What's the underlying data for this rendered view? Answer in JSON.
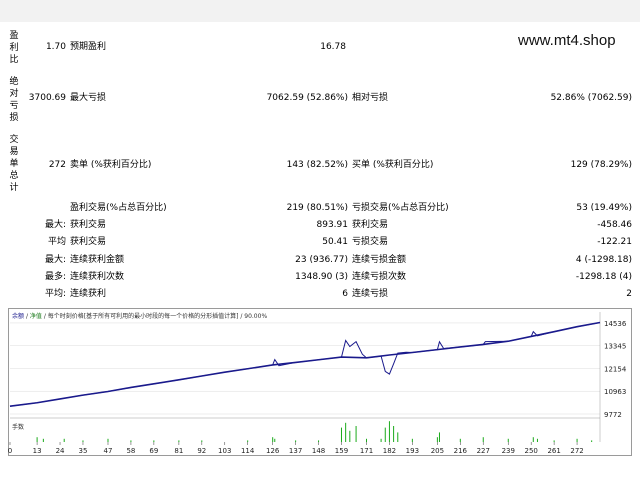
{
  "watermark": "www.mt4.shop",
  "left_labels": {
    "a": [
      "盈",
      "利",
      "比"
    ],
    "b": [
      "绝",
      "对",
      "亏",
      "损"
    ],
    "c": [
      "交",
      "易",
      "单",
      "总",
      "计"
    ]
  },
  "rows": {
    "r1": {
      "v1": "1.70",
      "l1": "预期盈利",
      "v2": "16.78"
    },
    "r2": {
      "v1": "3700.69",
      "l1": "最大亏损",
      "v2": "7062.59 (52.86%)",
      "l2": "相对亏损",
      "v3": "52.86% (7062.59)"
    },
    "r3": {
      "v1": "272",
      "l1": "卖单 (%获利百分比)",
      "v2": "143 (82.52%)",
      "l2": "买单 (%获利百分比)",
      "v3": "129 (78.29%)"
    },
    "r4": {
      "l1": "盈利交易(%占总百分比)",
      "v2": "219 (80.51%)",
      "l2": "亏损交易(%占总百分比)",
      "v3": "53 (19.49%)"
    },
    "r5": {
      "p": "最大:",
      "l1": "获利交易",
      "v2": "893.91",
      "l2": "获利交易",
      "v3": "-458.46"
    },
    "r6": {
      "p": "平均",
      "l1": "获利交易",
      "v2": "50.41",
      "l2": "亏损交易",
      "v3": "-122.21"
    },
    "r7": {
      "p": "最大:",
      "l1": "连续获利金额",
      "v2": "23 (936.77)",
      "l2": "连续亏损金额",
      "v3": "4 (-1298.18)"
    },
    "r8": {
      "p": "最多:",
      "l1": "连续获利次数",
      "v2": "1348.90 (3)",
      "l2": "连续亏损次数",
      "v3": "-1298.18 (4)"
    },
    "r9": {
      "p": "平均:",
      "l1": "连续获利",
      "v2": "6",
      "l2": "连续亏损",
      "v3": "2"
    }
  },
  "chart_legend": {
    "a": "余额",
    "b": "净值",
    "c": "每个时刻价格[基于所有可利用的最小时段的每一个价格的分形插值计算] / 90.00%"
  },
  "volume_label": "手数",
  "colors": {
    "balance": "#1a1a8c",
    "equity": "#1a1a8c",
    "volume": "#1aaa1a",
    "grid": "#dcdcdc"
  },
  "chart_data": {
    "type": "line",
    "x_ticks": [
      0,
      13,
      24,
      35,
      47,
      58,
      69,
      81,
      92,
      103,
      114,
      126,
      137,
      148,
      159,
      171,
      182,
      193,
      205,
      216,
      227,
      239,
      250,
      261,
      272
    ],
    "y_ticks": [
      9772,
      10963,
      12154,
      13345,
      14536
    ],
    "ylim": [
      9772,
      14900
    ],
    "xlim": [
      0,
      283
    ],
    "balance": [
      [
        0,
        10180
      ],
      [
        13,
        10360
      ],
      [
        24,
        10560
      ],
      [
        35,
        10760
      ],
      [
        47,
        10950
      ],
      [
        58,
        11160
      ],
      [
        69,
        11350
      ],
      [
        81,
        11560
      ],
      [
        92,
        11760
      ],
      [
        103,
        11960
      ],
      [
        114,
        12140
      ],
      [
        126,
        12340
      ],
      [
        137,
        12470
      ],
      [
        148,
        12610
      ],
      [
        159,
        12750
      ],
      [
        171,
        12710
      ],
      [
        182,
        12860
      ],
      [
        193,
        12990
      ],
      [
        205,
        13140
      ],
      [
        216,
        13280
      ],
      [
        227,
        13410
      ],
      [
        239,
        13580
      ],
      [
        250,
        13830
      ],
      [
        261,
        14080
      ],
      [
        272,
        14340
      ],
      [
        283,
        14560
      ]
    ],
    "equity": [
      [
        0,
        10180
      ],
      [
        13,
        10360
      ],
      [
        24,
        10560
      ],
      [
        35,
        10760
      ],
      [
        47,
        10950
      ],
      [
        58,
        11160
      ],
      [
        69,
        11350
      ],
      [
        81,
        11560
      ],
      [
        92,
        11760
      ],
      [
        103,
        11960
      ],
      [
        114,
        12140
      ],
      [
        126,
        12340
      ],
      [
        127,
        12620
      ],
      [
        129,
        12300
      ],
      [
        137,
        12470
      ],
      [
        148,
        12610
      ],
      [
        159,
        12750
      ],
      [
        161,
        13620
      ],
      [
        163,
        13300
      ],
      [
        166,
        13560
      ],
      [
        169,
        12900
      ],
      [
        171,
        12710
      ],
      [
        178,
        12800
      ],
      [
        180,
        12000
      ],
      [
        182,
        11860
      ],
      [
        184,
        12400
      ],
      [
        186,
        12960
      ],
      [
        190,
        13000
      ],
      [
        193,
        12990
      ],
      [
        205,
        13140
      ],
      [
        206,
        13550
      ],
      [
        208,
        13200
      ],
      [
        216,
        13280
      ],
      [
        227,
        13410
      ],
      [
        228,
        13560
      ],
      [
        239,
        13580
      ],
      [
        250,
        13830
      ],
      [
        251,
        14080
      ],
      [
        253,
        13860
      ],
      [
        261,
        14080
      ],
      [
        272,
        14340
      ],
      [
        283,
        14560
      ]
    ],
    "volume": [
      [
        13,
        3
      ],
      [
        16,
        2
      ],
      [
        26,
        2
      ],
      [
        35,
        1
      ],
      [
        47,
        2
      ],
      [
        58,
        1
      ],
      [
        69,
        1
      ],
      [
        81,
        1
      ],
      [
        92,
        1
      ],
      [
        114,
        1
      ],
      [
        126,
        3
      ],
      [
        127,
        2
      ],
      [
        137,
        1
      ],
      [
        148,
        1
      ],
      [
        159,
        9
      ],
      [
        161,
        12
      ],
      [
        163,
        7
      ],
      [
        166,
        10
      ],
      [
        171,
        2
      ],
      [
        178,
        2
      ],
      [
        180,
        9
      ],
      [
        182,
        13
      ],
      [
        184,
        10
      ],
      [
        186,
        6
      ],
      [
        193,
        2
      ],
      [
        205,
        3
      ],
      [
        206,
        6
      ],
      [
        216,
        2
      ],
      [
        227,
        3
      ],
      [
        239,
        2
      ],
      [
        251,
        3
      ],
      [
        253,
        2
      ],
      [
        261,
        1
      ],
      [
        272,
        2
      ],
      [
        279,
        1
      ]
    ]
  }
}
